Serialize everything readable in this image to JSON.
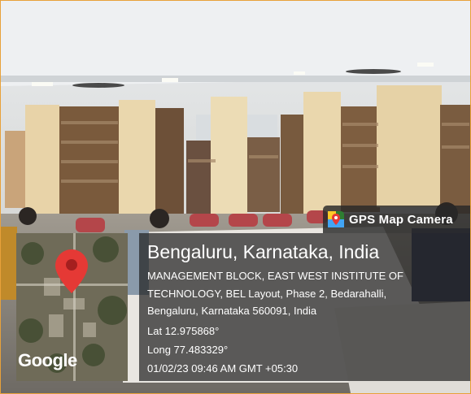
{
  "badge": {
    "label": "GPS Map Camera",
    "icon": "map-pin-app-icon"
  },
  "location": {
    "city": "Bengaluru, Karnataka, India",
    "address": "MANAGEMENT BLOCK, EAST WEST INSTITUTE OF TECHNOLOGY, BEL Layout, Phase 2, Bedarahalli, Bengaluru, Karnataka 560091, India",
    "lat": "Lat 12.975868°",
    "long": "Long 77.483329°",
    "datetime": "01/02/23 09:46 AM GMT +05:30"
  },
  "map": {
    "attribution": "Google",
    "pin_color": "#e53935"
  },
  "colors": {
    "frame": "#e8a13a",
    "overlay": "#232323"
  }
}
